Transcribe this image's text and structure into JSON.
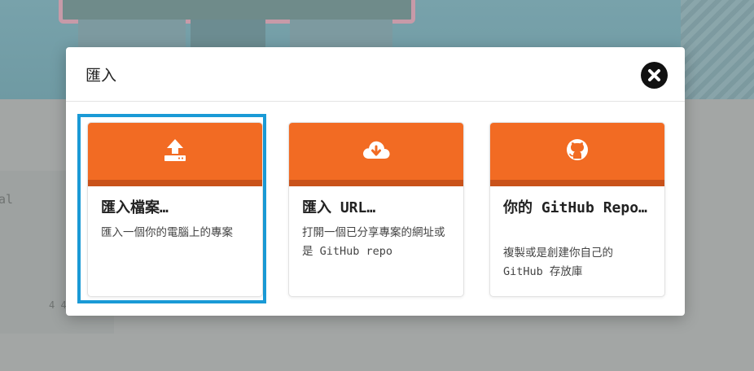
{
  "modal": {
    "title": "匯入",
    "close_icon": "close-icon"
  },
  "cards": [
    {
      "icon": "upload-icon",
      "title": "匯入檔案…",
      "description": "匯入一個你的電腦上的專案"
    },
    {
      "icon": "cloud-download-icon",
      "title": "匯入 URL…",
      "description": "打開一個已分享專案的網址或是 GitHub repo"
    },
    {
      "icon": "github-icon",
      "title": "你的 GitHub Repo…",
      "description": "複製或是創建你自己的 GitHub 存放庫"
    }
  ],
  "background": {
    "partial_text": "al",
    "partial_text2": "4 4"
  },
  "colors": {
    "accent": "#f26b23",
    "accent_dark": "#c9521a",
    "focus": "#1a9ad6"
  }
}
